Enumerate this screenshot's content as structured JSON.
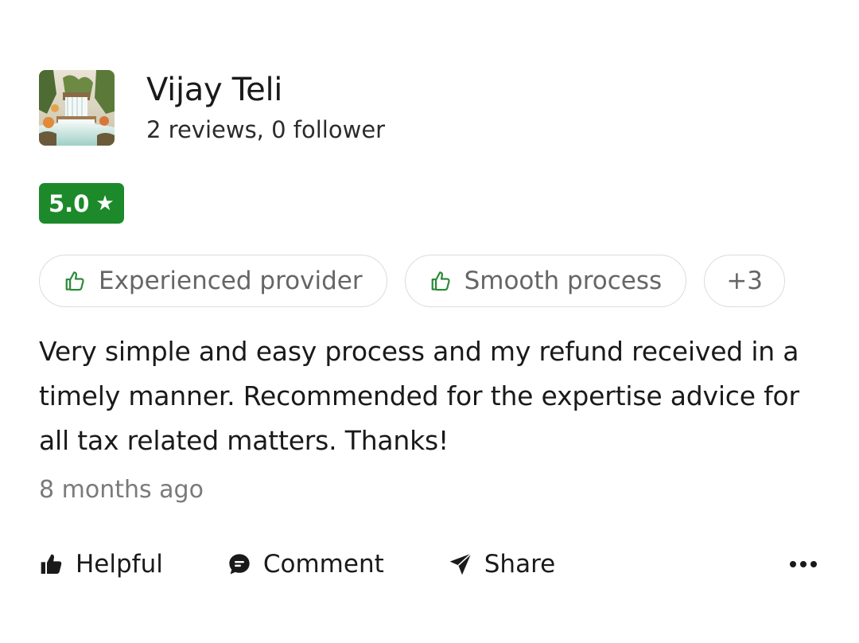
{
  "reviewer": {
    "name": "Vijay Teli",
    "stats": "2 reviews, 0 follower",
    "avatar_icon": "waterfall-landscape-image"
  },
  "rating": {
    "value": "5.0",
    "star": "★",
    "badge_color": "#1c8a2a"
  },
  "tags": {
    "items": [
      {
        "label": "Experienced provider",
        "icon": "thumbs-up-outline-icon"
      },
      {
        "label": "Smooth process",
        "icon": "thumbs-up-outline-icon"
      }
    ],
    "more_label": "+3"
  },
  "review": {
    "text": "Very simple and easy process and my refund received in a timely manner. Recommended for the expertise advice for all tax related matters. Thanks!",
    "time": "8 months ago"
  },
  "actions": {
    "helpful_label": "Helpful",
    "comment_label": "Comment",
    "share_label": "Share",
    "more_icon": "more-dots-icon"
  },
  "colors": {
    "tag_icon": "#2e8b3a",
    "muted_text": "#7a7a7a"
  }
}
